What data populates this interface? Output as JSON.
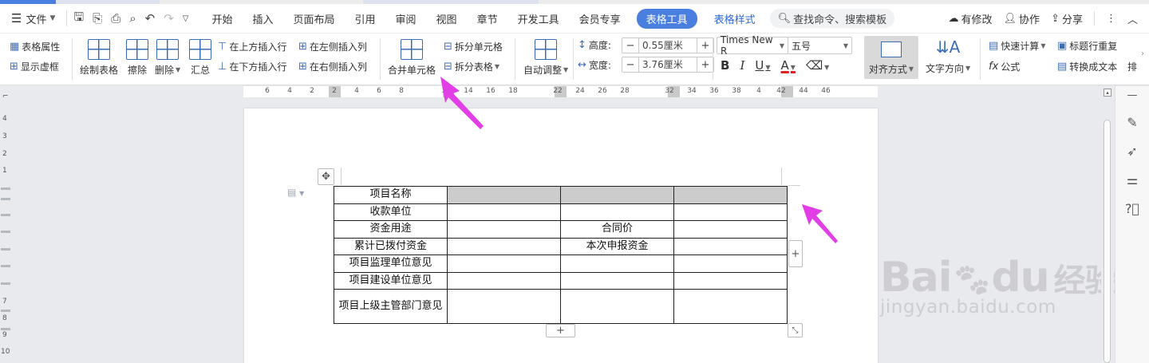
{
  "menubar": {
    "file_label": "文件",
    "tabs": [
      "开始",
      "插入",
      "页面布局",
      "引用",
      "审阅",
      "视图",
      "章节",
      "开发工具",
      "会员专享"
    ],
    "active_tab": "表格工具",
    "extra_tab": "表格样式",
    "search_placeholder": "查找命令、搜索模板",
    "modified_label": "有修改",
    "collab_label": "协作",
    "share_label": "分享"
  },
  "ribbon": {
    "table_props": "表格属性",
    "show_gridlines": "显示虚框",
    "draw_table": "绘制表格",
    "erase": "擦除",
    "delete": "删除",
    "summary": "汇总",
    "insert_row_above": "在上方插入行",
    "insert_row_below": "在下方插入行",
    "insert_col_left": "在左侧插入列",
    "insert_col_right": "在右侧插入列",
    "merge_cells": "合并单元格",
    "split_cells": "拆分单元格",
    "split_table": "拆分表格",
    "auto_adjust": "自动调整",
    "height_label": "高度:",
    "height_value": "0.55厘米",
    "width_label": "宽度:",
    "width_value": "3.76厘米",
    "font_name": "Times New R",
    "font_size": "五号",
    "align": "对齐方式",
    "text_direction": "文字方向",
    "quick_calc": "快速计算",
    "formula": "公式",
    "title_repeat": "标题行重复",
    "convert_text": "转换成文本",
    "overflow": "排"
  },
  "ruler": {
    "numbers": [
      "6",
      "4",
      "2",
      "2",
      "4",
      "6",
      "8",
      "",
      "12",
      "14",
      "16",
      "18",
      "",
      "22",
      "24",
      "26",
      "28",
      "",
      "32",
      "34",
      "36",
      "38",
      "4",
      "42",
      "44",
      "46"
    ]
  },
  "vruler": {
    "numbers": [
      "4",
      "3",
      "2",
      "1",
      "7",
      "8",
      "9",
      "10"
    ]
  },
  "table": {
    "rows": [
      [
        "项目名称",
        "",
        "",
        ""
      ],
      [
        "收款单位",
        "",
        "",
        ""
      ],
      [
        "资金用途",
        "",
        "合同价",
        ""
      ],
      [
        "累计已拨付资金",
        "",
        "本次申报资金",
        ""
      ],
      [
        "项目监理单位意见",
        "",
        "",
        ""
      ],
      [
        "项目建设单位意见",
        "",
        "",
        ""
      ],
      [
        "项目上级主管部门意见",
        "",
        "",
        ""
      ]
    ]
  },
  "watermark": {
    "brand": "Bai",
    "brand_mid": "du",
    "brand_cn": "经验",
    "url": "jingyan.baidu.com"
  },
  "colors": {
    "accent": "#4a7fe0",
    "arrow": "#e23ee6",
    "header_fill": "#cccccc"
  }
}
